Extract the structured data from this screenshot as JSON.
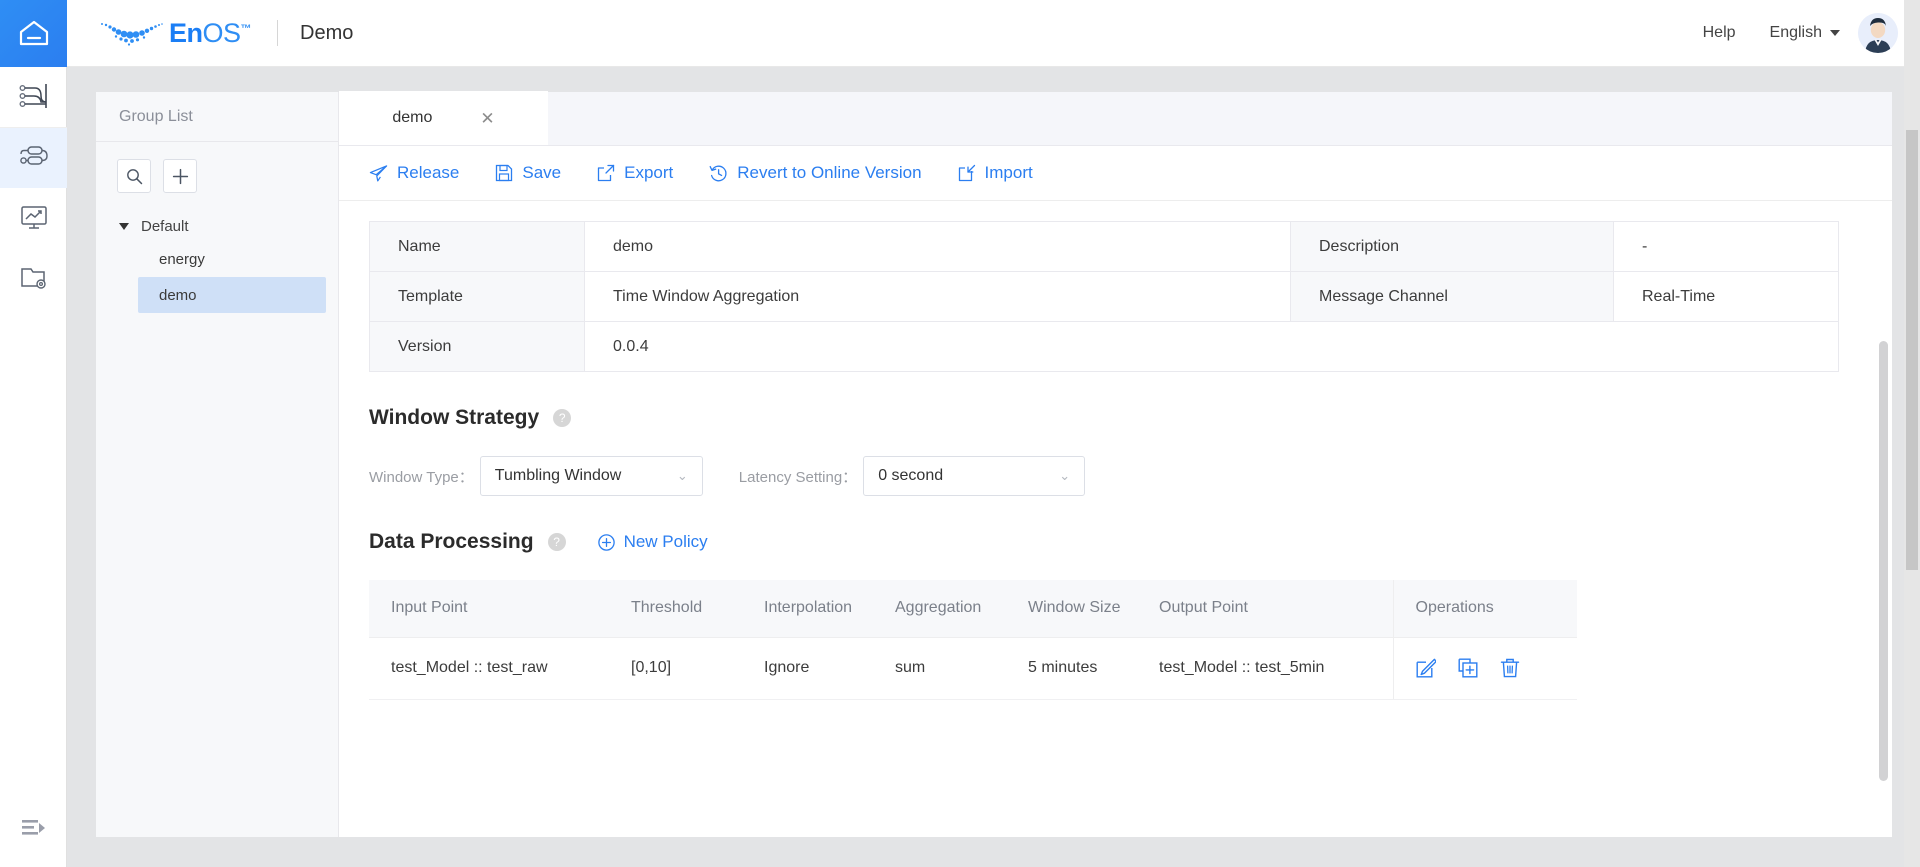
{
  "header": {
    "home_icon": "home-icon",
    "brand": {
      "en": "En",
      "os": "OS",
      "tm": "™"
    },
    "app_title": "Demo",
    "help_label": "Help",
    "language_label": "English",
    "avatar_icon": "user-avatar"
  },
  "rail": {
    "items": [
      {
        "name": "workflow-icon",
        "label": "Workflow",
        "active": false
      },
      {
        "name": "stream-processing-icon",
        "label": "Stream Processing",
        "active": true
      },
      {
        "name": "analytics-monitor-icon",
        "label": "Analytics",
        "active": false
      },
      {
        "name": "folder-settings-icon",
        "label": "Resource Management",
        "active": false
      }
    ],
    "collapse_icon": "collapse-sidebar-icon"
  },
  "group_panel": {
    "title": "Group List",
    "search_icon": "search-icon",
    "add_icon": "plus-icon",
    "tree": {
      "root_label": "Default",
      "children": [
        {
          "label": "energy",
          "selected": false
        },
        {
          "label": "demo",
          "selected": true
        }
      ]
    }
  },
  "tabs": [
    {
      "label": "demo",
      "close": "✕",
      "active": true
    }
  ],
  "toolbar": {
    "buttons": [
      {
        "icon": "send-release-icon",
        "label": "Release"
      },
      {
        "icon": "save-disk-icon",
        "label": "Save"
      },
      {
        "icon": "export-icon",
        "label": "Export"
      },
      {
        "icon": "revert-clock-icon",
        "label": "Revert to Online Version"
      },
      {
        "icon": "import-icon",
        "label": "Import"
      }
    ]
  },
  "info_table": {
    "rows": [
      {
        "label": "Name",
        "value": "demo",
        "label2": "Description",
        "value2": "-"
      },
      {
        "label": "Template",
        "value": "Time Window Aggregation",
        "label2": "Message Channel",
        "value2": "Real-Time"
      },
      {
        "label": "Version",
        "value": "0.0.4",
        "label2": "",
        "value2": ""
      }
    ]
  },
  "window_strategy": {
    "title": "Window Strategy",
    "help_icon": "question-mark-icon",
    "window_type_label": "Window Type：",
    "window_type_value": "Tumbling Window",
    "latency_label": "Latency Setting：",
    "latency_value": "0 second",
    "chevron": "⌄"
  },
  "data_processing": {
    "title": "Data Processing",
    "help_icon": "question-mark-icon",
    "new_policy_label": "New Policy",
    "new_policy_icon": "plus-circle-icon",
    "columns": [
      "Input Point",
      "Threshold",
      "Interpolation",
      "Aggregation",
      "Window Size",
      "Output Point",
      "Operations"
    ],
    "rows": [
      {
        "input_point": "test_Model :: test_raw",
        "threshold": "[0,10]",
        "interpolation": "Ignore",
        "aggregation": "sum",
        "window_size": "5 minutes",
        "output_point": "test_Model :: test_5min",
        "operations": [
          {
            "icon": "edit-pencil-icon",
            "label": "Edit"
          },
          {
            "icon": "copy-add-icon",
            "label": "Duplicate"
          },
          {
            "icon": "trash-delete-icon",
            "label": "Delete"
          }
        ]
      }
    ]
  },
  "colors": {
    "accent": "#2b7ef0",
    "home_tile": "#2f8ef4",
    "selected_row": "#cfe0f7",
    "panel_bg": "#f7f8fa"
  }
}
